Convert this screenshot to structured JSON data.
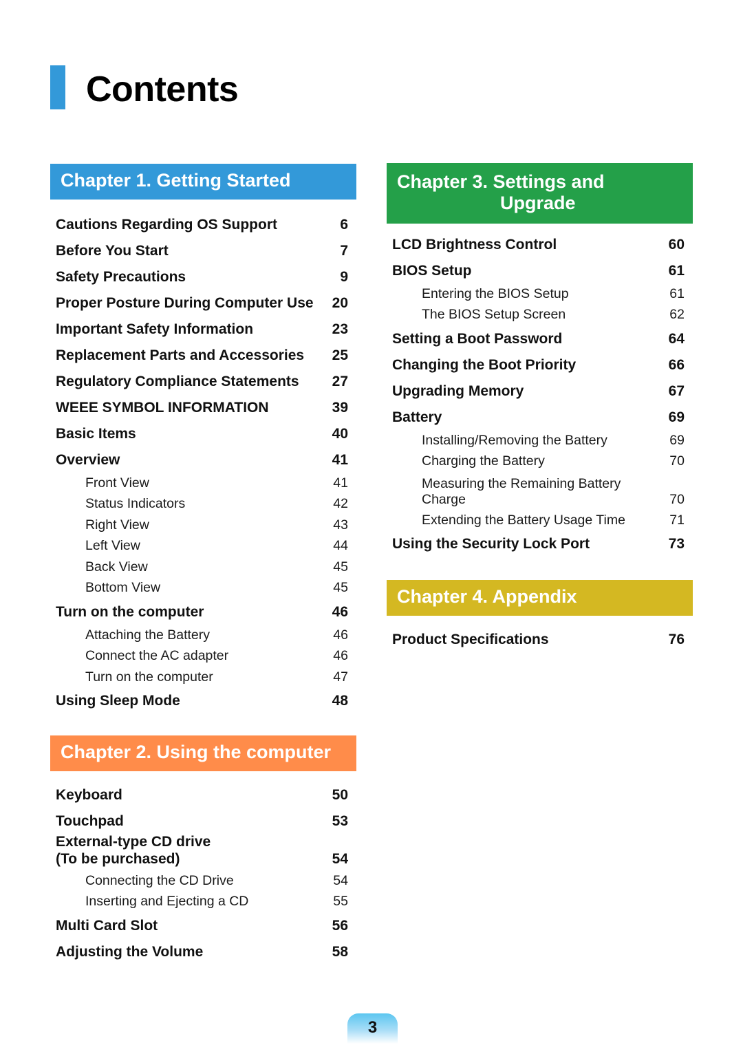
{
  "page": {
    "title": "Contents",
    "page_number": "3",
    "accent_colors": {
      "title_bar": "#3399d9",
      "chapter1": "#3399d9",
      "chapter2": "#ff8c4a",
      "chapter3": "#24a049",
      "chapter4": "#d4b822"
    }
  },
  "chapters": {
    "ch1": {
      "title": "Chapter 1. Getting Started",
      "items": [
        {
          "label": "Cautions Regarding OS Support",
          "page": "6",
          "level": 1
        },
        {
          "label": "Before You Start",
          "page": "7",
          "level": 1
        },
        {
          "label": "Safety Precautions",
          "page": "9",
          "level": 1
        },
        {
          "label": "Proper Posture During Computer Use",
          "page": "20",
          "level": 1
        },
        {
          "label": "Important Safety Information",
          "page": "23",
          "level": 1
        },
        {
          "label": "Replacement Parts and Accessories",
          "page": "25",
          "level": 1
        },
        {
          "label": "Regulatory Compliance Statements",
          "page": "27",
          "level": 1
        },
        {
          "label": "WEEE SYMBOL INFORMATION",
          "page": "39",
          "level": 1
        },
        {
          "label": "Basic Items",
          "page": "40",
          "level": 1
        },
        {
          "label": "Overview",
          "page": "41",
          "level": 1
        },
        {
          "label": "Front View",
          "page": "41",
          "level": 2
        },
        {
          "label": "Status Indicators",
          "page": "42",
          "level": 2
        },
        {
          "label": "Right View",
          "page": "43",
          "level": 2
        },
        {
          "label": "Left View",
          "page": "44",
          "level": 2
        },
        {
          "label": "Back View",
          "page": "45",
          "level": 2
        },
        {
          "label": "Bottom View",
          "page": "45",
          "level": 2
        },
        {
          "label": "Turn on the computer",
          "page": "46",
          "level": 1
        },
        {
          "label": "Attaching the Battery",
          "page": "46",
          "level": 2
        },
        {
          "label": "Connect the AC adapter",
          "page": "46",
          "level": 2
        },
        {
          "label": "Turn on the computer",
          "page": "47",
          "level": 2
        },
        {
          "label": "Using Sleep Mode",
          "page": "48",
          "level": 1
        }
      ]
    },
    "ch2": {
      "title": "Chapter 2. Using the computer",
      "items": [
        {
          "label": "Keyboard",
          "page": "50",
          "level": 1
        },
        {
          "label": "Touchpad",
          "page": "53",
          "level": 1
        },
        {
          "label": "External-type CD drive\n(To be purchased)",
          "page": "54",
          "level": 1,
          "multi": true
        },
        {
          "label": "Connecting the CD Drive",
          "page": "54",
          "level": 2
        },
        {
          "label": "Inserting and Ejecting a CD",
          "page": "55",
          "level": 2
        },
        {
          "label": "Multi Card Slot",
          "page": "56",
          "level": 1
        },
        {
          "label": "Adjusting the Volume",
          "page": "58",
          "level": 1
        }
      ]
    },
    "ch3": {
      "title_line1": "Chapter 3. Settings and",
      "title_line2": "Upgrade",
      "items": [
        {
          "label": "LCD Brightness Control",
          "page": "60",
          "level": 1
        },
        {
          "label": "BIOS Setup",
          "page": "61",
          "level": 1
        },
        {
          "label": "Entering the BIOS Setup",
          "page": "61",
          "level": 2
        },
        {
          "label": "The BIOS Setup Screen",
          "page": "62",
          "level": 2
        },
        {
          "label": "Setting a Boot Password",
          "page": "64",
          "level": 1
        },
        {
          "label": "Changing the Boot Priority",
          "page": "66",
          "level": 1
        },
        {
          "label": "Upgrading Memory",
          "page": "67",
          "level": 1
        },
        {
          "label": "Battery",
          "page": "69",
          "level": 1
        },
        {
          "label": "Installing/Removing the Battery",
          "page": "69",
          "level": 2
        },
        {
          "label": "Charging the Battery",
          "page": "70",
          "level": 2
        },
        {
          "label": "Measuring the Remaining Battery\nCharge",
          "page": "70",
          "level": 2,
          "multi": true
        },
        {
          "label": "Extending the Battery Usage Time",
          "page": "71",
          "level": 2
        },
        {
          "label": "Using the Security Lock Port",
          "page": "73",
          "level": 1
        }
      ]
    },
    "ch4": {
      "title": "Chapter 4. Appendix",
      "items": [
        {
          "label": "Product Specifications",
          "page": "76",
          "level": 1
        }
      ]
    }
  }
}
